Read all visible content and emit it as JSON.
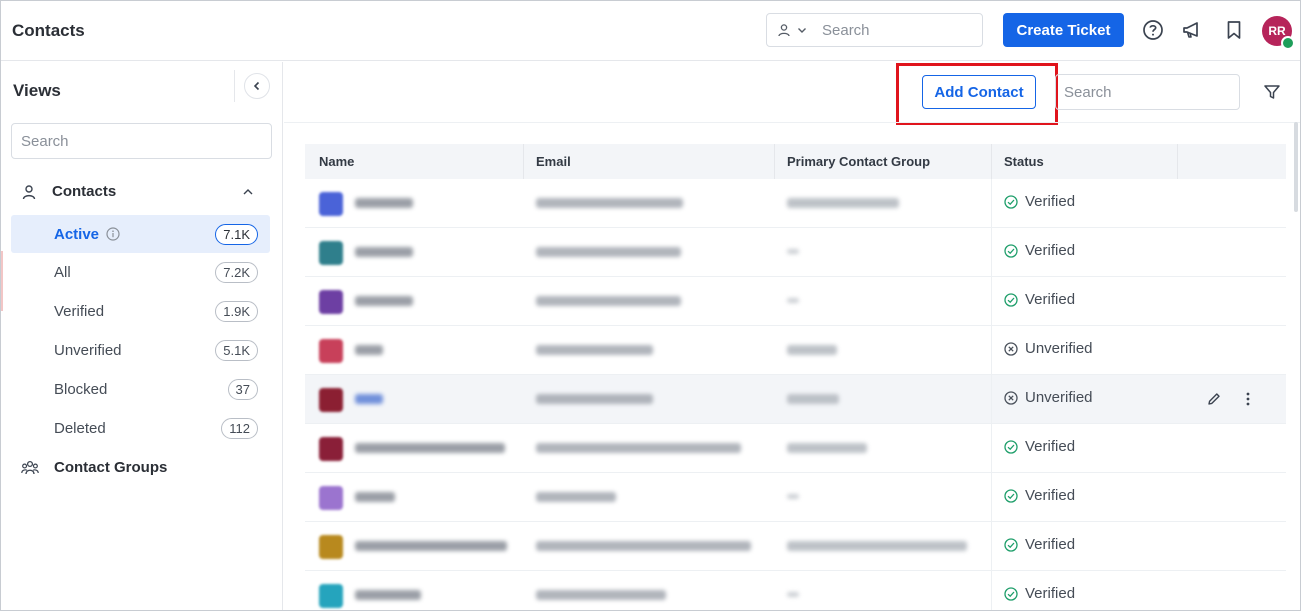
{
  "header": {
    "title": "Contacts",
    "search_placeholder": "Search",
    "create_ticket_label": "Create Ticket",
    "avatar_initials": "RR",
    "icons": [
      "help-icon",
      "megaphone-icon",
      "bookmark-icon"
    ]
  },
  "sidebar": {
    "title": "Views",
    "search_placeholder": "Search",
    "contacts_group_label": "Contacts",
    "contact_groups_label": "Contact Groups",
    "items": [
      {
        "label": "Active",
        "count": "7.1K",
        "active": true
      },
      {
        "label": "All",
        "count": "7.2K"
      },
      {
        "label": "Verified",
        "count": "1.9K"
      },
      {
        "label": "Unverified",
        "count": "5.1K"
      },
      {
        "label": "Blocked",
        "count": "37"
      },
      {
        "label": "Deleted",
        "count": "112"
      }
    ]
  },
  "toolbar": {
    "add_contact_label": "Add Contact",
    "search_placeholder": "Search"
  },
  "table": {
    "columns": [
      "Name",
      "Email",
      "Primary Contact Group",
      "Status"
    ],
    "rows": [
      {
        "status": "Verified",
        "avatar_color": "#4a63d8"
      },
      {
        "status": "Verified",
        "avatar_color": "#2f7f8c"
      },
      {
        "status": "Verified",
        "avatar_color": "#6d3fa3"
      },
      {
        "status": "Unverified",
        "avatar_color": "#c8405a"
      },
      {
        "status": "Unverified",
        "avatar_color": "#8b1f32"
      },
      {
        "status": "Verified",
        "avatar_color": "#8a1f38"
      },
      {
        "status": "Verified",
        "avatar_color": "#9b74cf"
      },
      {
        "status": "Verified",
        "avatar_color": "#b8891e"
      },
      {
        "status": "Verified",
        "avatar_color": "#25a4bd"
      }
    ]
  },
  "colors": {
    "primary": "#1565e6",
    "verified": "#1e9e6a",
    "highlight": "#e0141c",
    "avatar": "#b6245a"
  }
}
